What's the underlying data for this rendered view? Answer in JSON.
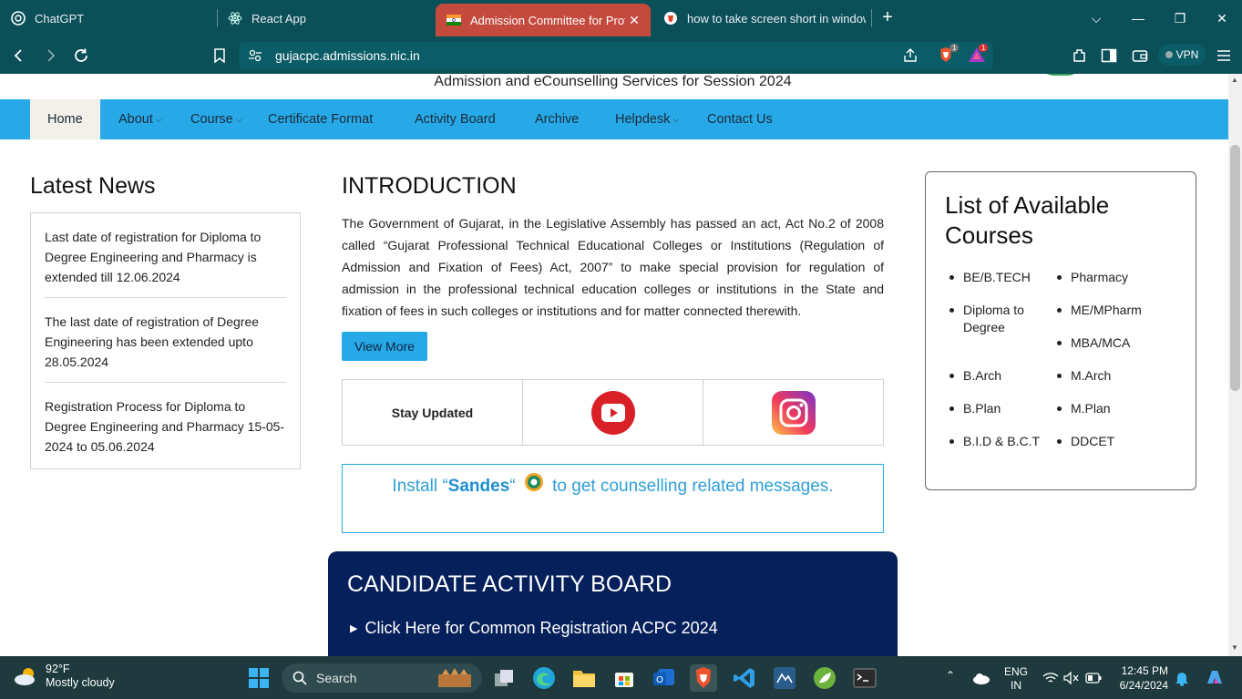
{
  "browser": {
    "tabs": [
      {
        "title": "ChatGPT",
        "icon": "chatgpt-icon"
      },
      {
        "title": "React App",
        "icon": "react-icon"
      },
      {
        "title": "Admission Committee for Profes",
        "icon": "india-flag-icon"
      },
      {
        "title": "how to take screen short in windows",
        "icon": "brave-search-icon"
      }
    ],
    "url": "gujacpc.admissions.nic.in",
    "vpn_label": "VPN",
    "brave_badge": "1",
    "rewards_badge": "1"
  },
  "page": {
    "subtitle": "Admission and eCounselling Services for Session 2024",
    "nav": {
      "home": "Home",
      "about": "About",
      "course": "Course",
      "certificate": "Certificate Format",
      "activity": "Activity Board",
      "archive": "Archive",
      "helpdesk": "Helpdesk",
      "contact": "Contact Us"
    },
    "news": {
      "title": "Latest News",
      "items": [
        "Last date of registration for Diploma to Degree Engineering and Pharmacy is extended till 12.06.2024",
        "The last date of registration of Degree Engineering has been extended upto 28.05.2024",
        "Registration Process for Diploma to Degree Engineering and Pharmacy 15-05-2024 to 05.06.2024"
      ]
    },
    "intro": {
      "title": "INTRODUCTION",
      "text": "The Government of Gujarat, in the Legislative Assembly has passed an act, Act No.2 of 2008 called “Gujarat Professional Technical Educational Colleges or Institutions (Regulation of Admission and Fixation of Fees) Act, 2007” to make special provision for regulation of admission in the professional technical education colleges or institutions in the State and fixation of fees in such colleges or institutions and for matter connected therewith.",
      "view_more": "View More"
    },
    "stay_updated": "Stay Updated",
    "sandes": {
      "prefix": "Install “",
      "name": "Sandes",
      "suffix": "“",
      "rest": "to get counselling related messages."
    },
    "activity_board": {
      "title": "CANDIDATE ACTIVITY BOARD",
      "link": "Click Here for Common Registration ACPC 2024"
    },
    "courses": {
      "title": "List of Available Courses",
      "left": [
        "BE/B.TECH",
        "Diploma to Degree",
        "B.Arch",
        "B.Plan",
        "B.I.D & B.C.T"
      ],
      "right": [
        "Pharmacy",
        "ME/MPharm",
        "MBA/MCA",
        "M.Arch",
        "M.Plan",
        "DDCET"
      ]
    }
  },
  "taskbar": {
    "temp": "92°F",
    "weather": "Mostly cloudy",
    "search": "Search",
    "lang1": "ENG",
    "lang2": "IN",
    "time": "12:45 PM",
    "date": "6/24/2024"
  },
  "colors": {
    "browser_frame": "#0b4f59",
    "active_tab": "#c44a3e",
    "nav_blue": "#27a9e8",
    "activity_navy": "#05205a"
  }
}
